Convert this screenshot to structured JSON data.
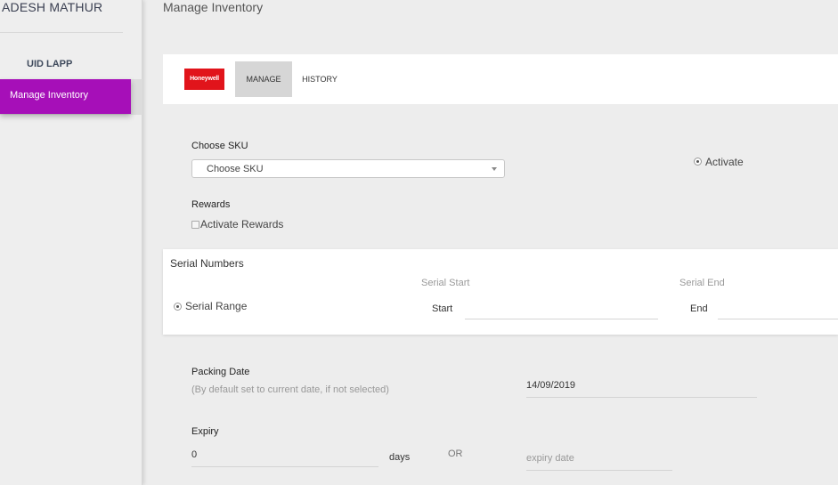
{
  "sidebar": {
    "user_name": "ADESH MATHUR",
    "org": "UID LAPP",
    "nav_active": "Manage Inventory",
    "accent_color": "#a60fb8"
  },
  "page": {
    "title": "Manage Inventory"
  },
  "tabs": {
    "brand": "Honeywell",
    "items": [
      {
        "label": "MANAGE",
        "selected": true
      },
      {
        "label": "HISTORY",
        "selected": false
      }
    ]
  },
  "form": {
    "sku": {
      "label": "Choose SKU",
      "selected": "Choose SKU"
    },
    "activate": {
      "label": "Activate",
      "checked": true
    },
    "rewards": {
      "label": "Rewards",
      "checkbox_label": "Activate Rewards",
      "checked": false
    },
    "serials": {
      "title": "Serial Numbers",
      "mode_label": "Serial Range",
      "start_header": "Serial Start",
      "end_header": "Serial End",
      "start_label": "Start",
      "end_label": "End",
      "start_value": "",
      "end_value": ""
    },
    "packing": {
      "label": "Packing Date",
      "hint": "(By default set to current date, if not selected)",
      "value": "14/09/2019"
    },
    "expiry": {
      "label": "Expiry",
      "days_value": "0",
      "days_unit": "days",
      "or_text": "OR",
      "date_placeholder": "expiry date"
    }
  }
}
